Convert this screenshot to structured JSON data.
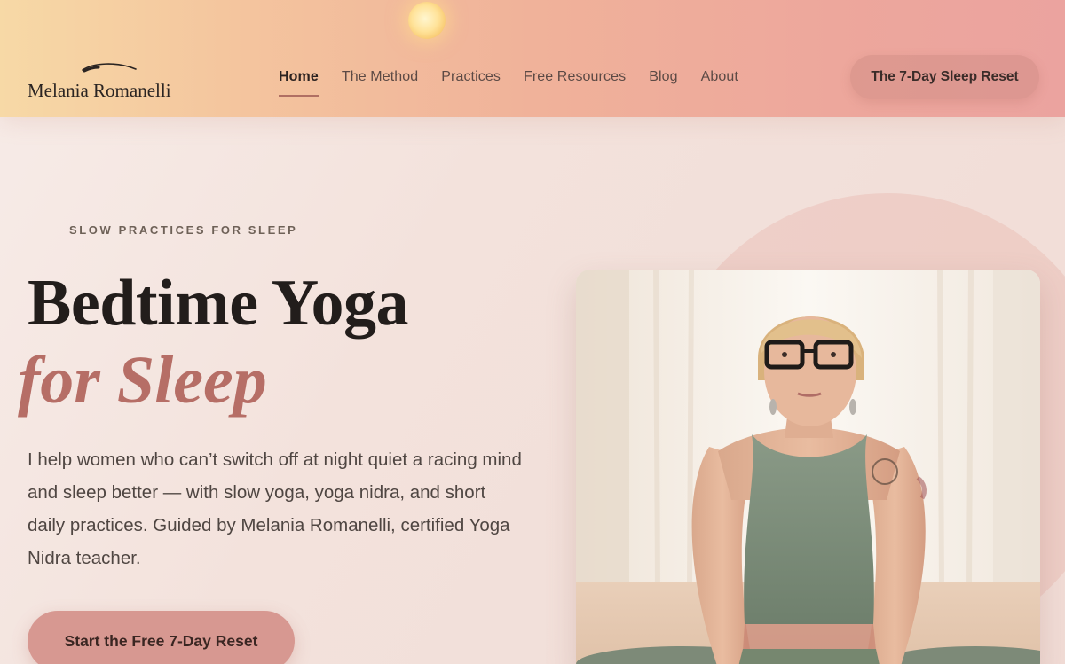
{
  "brand": {
    "name": "Melania Romanelli"
  },
  "nav": {
    "items": [
      "Home",
      "The Method",
      "Practices",
      "Free Resources",
      "Blog",
      "About"
    ],
    "active": "Home"
  },
  "header_cta": {
    "label": "The 7-Day Sleep Reset"
  },
  "hero": {
    "eyebrow": "SLOW PRACTICES FOR SLEEP",
    "title_line1": "Bedtime Yoga",
    "title_line2": "for Sleep",
    "intro": "I help women who can’t switch off at night quiet a racing mind and sleep better — with slow yoga, yoga nidra, and short daily practices. Guided by Melania Romanelli, certified Yoga Nidra teacher.",
    "cta_label": "Start the Free 7-Day Reset"
  },
  "colors": {
    "header_gradient": [
      "#f7d9a6",
      "#f0b29a",
      "#eba39f"
    ],
    "accent": "#b66e66",
    "cta_main": "#d79891",
    "text_dark": "#221d1b"
  },
  "icons": {
    "logo": "crescent-brush-icon",
    "sun": "sun-orb-icon"
  }
}
